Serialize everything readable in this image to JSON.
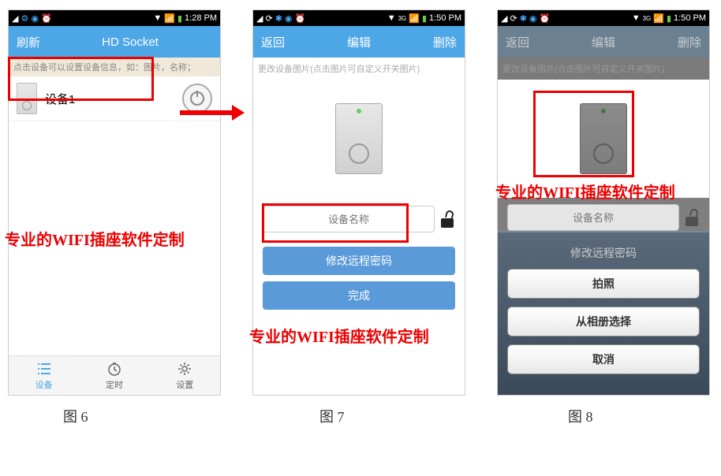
{
  "phone1": {
    "status": {
      "time": "1:28 PM"
    },
    "topbar": {
      "left": "刷新",
      "center": "HD Socket"
    },
    "hint": "点击设备可以设置设备信息，如：图片，名称；",
    "device": {
      "name": "设备1"
    },
    "tabs": {
      "devices": "设备",
      "timer": "定时",
      "settings": "设置"
    },
    "watermark": "专业的WIFI插座软件定制"
  },
  "phone2": {
    "status": {
      "time": "1:50 PM"
    },
    "topbar": {
      "back": "返回",
      "title": "编辑",
      "delete": "删除"
    },
    "hint": "更改设备图片(点击图片可自定义开关图片)",
    "name_placeholder": "设备名称",
    "btn_edit_pw": "修改远程密码",
    "btn_done": "完成",
    "watermark": "专业的WIFI插座软件定制"
  },
  "phone3": {
    "status": {
      "time": "1:50 PM"
    },
    "topbar": {
      "back": "返回",
      "title": "编辑",
      "delete": "删除"
    },
    "hint": "更改设备图片(点击图片可自定义开关图片)",
    "name_placeholder": "设备名称",
    "sheet_title": "修改远程密码",
    "btn_camera": "拍照",
    "btn_album": "从相册选择",
    "btn_cancel": "取消",
    "watermark": "专业的WIFI插座软件定制"
  },
  "captions": {
    "fig6": "图 6",
    "fig7": "图 7",
    "fig8": "图 8"
  }
}
